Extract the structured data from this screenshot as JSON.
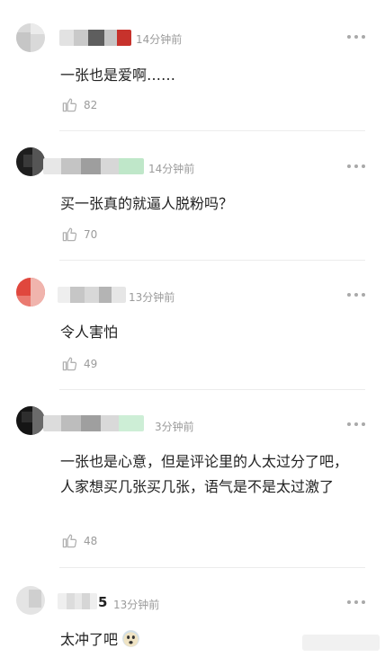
{
  "comments": [
    {
      "name_suffix": "",
      "time": "14分钟前",
      "text": "一张也是爱啊……",
      "likes": "82",
      "avatar_colors": [
        "#d9d9d9",
        "#c6c6c6"
      ],
      "name_colors": [
        "#e2e2e2",
        "#c9c9c9",
        "#5e5e5e",
        "#c6c6c6",
        "#c7322c"
      ]
    },
    {
      "name_suffix": "",
      "time": "14分钟前",
      "text": "买一张真的就逼人脱粉吗？",
      "likes": "70",
      "avatar_colors": [
        "#1e1e1e",
        "#555555"
      ],
      "name_colors": [
        "#e7e7e7",
        "#c4c4c4",
        "#9e9e9e",
        "#d7d7d7",
        "#bfe7c9"
      ]
    },
    {
      "name_suffix": "",
      "time": "13分钟前",
      "text": "令人害怕",
      "likes": "49",
      "avatar_colors": [
        "#e0473d",
        "#f0b4ad"
      ],
      "name_colors": [
        "#eeeeee",
        "#c6c6c6",
        "#d8d8d8",
        "#b4b4b4",
        "#e6e6e6"
      ]
    },
    {
      "name_suffix": "",
      "time": "3分钟前",
      "text": "一张也是心意，但是评论里的人太过分了吧，人家想买几张买几张，语气是不是太过激了",
      "likes": "48",
      "avatar_colors": [
        "#151515",
        "#6a6a6a"
      ],
      "name_colors": [
        "#dcdcdc",
        "#bdbdbd",
        "#9f9f9f",
        "#d9d9d9",
        "#cdeed6"
      ]
    },
    {
      "name_suffix": "5",
      "time": "13分钟前",
      "text": "太冲了吧",
      "likes": "",
      "avatar_colors": [
        "#e4e4e4",
        "#cfcfcf"
      ],
      "name_colors": [
        "#efefef",
        "#dcdcdc",
        "#e8e8e8",
        "#d6d6d6",
        "#eeeeee"
      ]
    }
  ],
  "icons": {
    "like": "thumbs-up-icon",
    "more": "more-dots-icon",
    "emoji": "fearful-face-emoji-icon"
  },
  "colors": {
    "text": "#222222",
    "meta": "#9b9b9b",
    "divider": "#ececec",
    "icon": "#b0b0b0"
  }
}
